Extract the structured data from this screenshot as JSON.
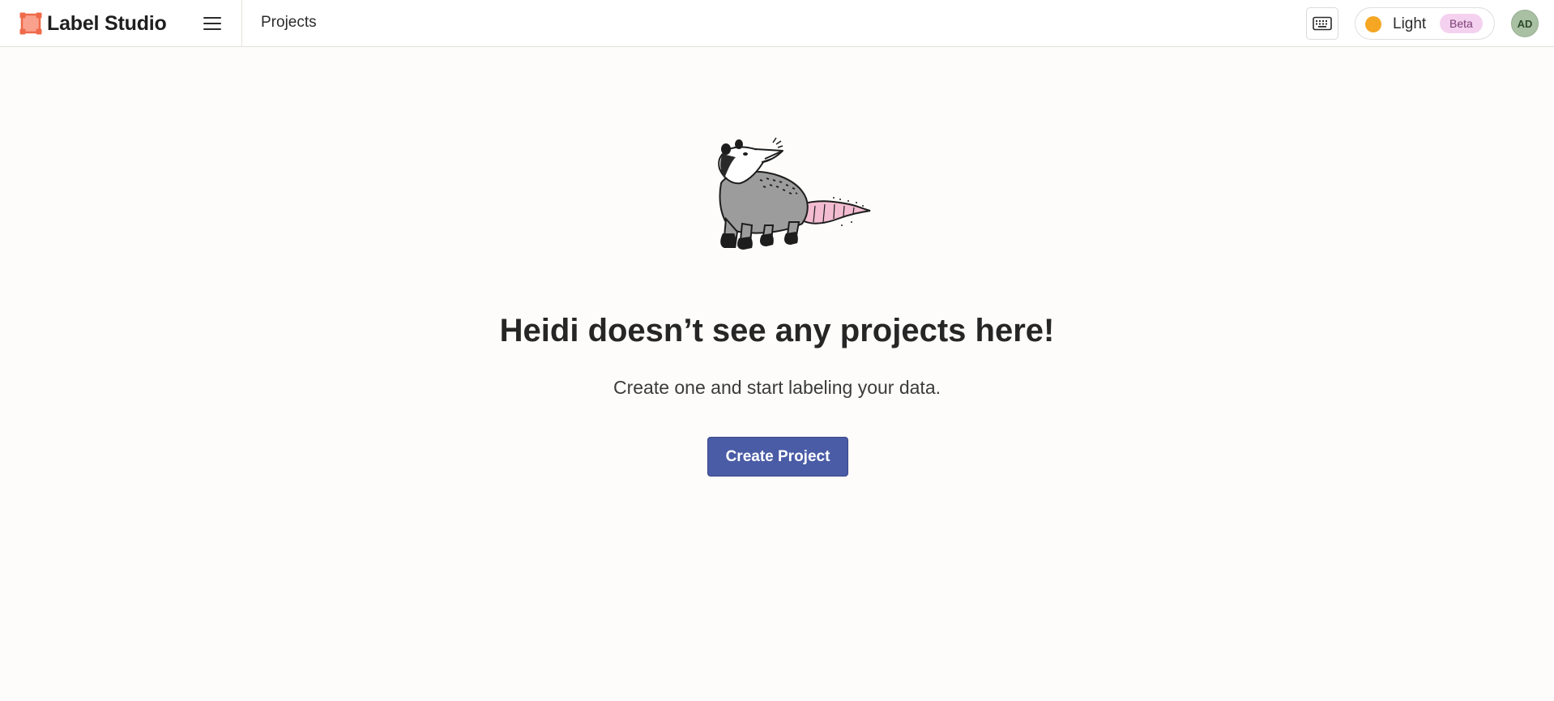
{
  "app": {
    "name": "Label Studio",
    "brand_color": "#f26a4b"
  },
  "header": {
    "breadcrumb": "Projects",
    "menu_icon": "hamburger-menu-icon",
    "keyboard_icon": "keyboard-icon",
    "theme": {
      "label": "Light",
      "badge": "Beta",
      "indicator_color": "#f5a623"
    },
    "user": {
      "initials": "AD",
      "avatar_color": "#a9c0a3"
    }
  },
  "empty_state": {
    "illustration": "opossum-illustration",
    "title": "Heidi doesn’t see any projects here!",
    "subtitle": "Create one and start labeling your data.",
    "create_button": "Create Project",
    "button_color": "#4a5ca6"
  }
}
